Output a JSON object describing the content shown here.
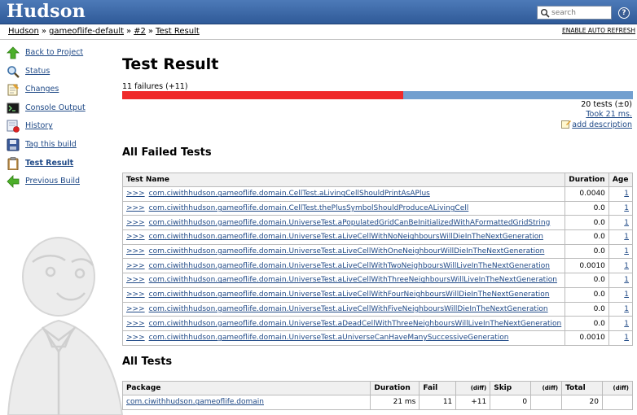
{
  "header": {
    "logo": "Hudson",
    "search_placeholder": "search",
    "help_glyph": "?"
  },
  "breadcrumb": {
    "items": [
      "Hudson",
      "gameoflife-default",
      "#2",
      "Test Result"
    ],
    "separator": "»",
    "auto_refresh": "ENABLE AUTO REFRESH"
  },
  "sidebar": {
    "items": [
      {
        "label": "Back to Project",
        "icon": "up-arrow-icon"
      },
      {
        "label": "Status",
        "icon": "magnifier-icon"
      },
      {
        "label": "Changes",
        "icon": "notepad-icon"
      },
      {
        "label": "Console Output",
        "icon": "terminal-icon"
      },
      {
        "label": "History",
        "icon": "history-icon"
      },
      {
        "label": "Tag this build",
        "icon": "floppy-disk-icon"
      },
      {
        "label": "Test Result",
        "icon": "clipboard-icon"
      },
      {
        "label": "Previous Build",
        "icon": "left-arrow-icon"
      }
    ]
  },
  "main": {
    "title": "Test Result",
    "failures": "11 failures (+11)",
    "fail_fraction": 0.55,
    "tests": "20 tests (±0)",
    "took": "Took 21 ms.",
    "add_description": "add description"
  },
  "failed": {
    "heading": "All Failed Tests",
    "columns": {
      "name": "Test Name",
      "duration": "Duration",
      "age": "Age"
    },
    "arrow": ">>>",
    "rows": [
      {
        "name": "com.ciwithhudson.gameoflife.domain.CellTest.aLivingCellShouldPrintAsAPlus",
        "duration": "0.0040",
        "age": "1"
      },
      {
        "name": "com.ciwithhudson.gameoflife.domain.CellTest.thePlusSymbolShouldProduceALivingCell",
        "duration": "0.0",
        "age": "1"
      },
      {
        "name": "com.ciwithhudson.gameoflife.domain.UniverseTest.aPopulatedGridCanBeInitializedWithAFormattedGridString",
        "duration": "0.0",
        "age": "1"
      },
      {
        "name": "com.ciwithhudson.gameoflife.domain.UniverseTest.aLiveCellWithNoNeighboursWillDieInTheNextGeneration",
        "duration": "0.0",
        "age": "1"
      },
      {
        "name": "com.ciwithhudson.gameoflife.domain.UniverseTest.aLiveCellWithOneNeighbourWillDieInTheNextGeneration",
        "duration": "0.0",
        "age": "1"
      },
      {
        "name": "com.ciwithhudson.gameoflife.domain.UniverseTest.aLiveCellWithTwoNeighboursWillLiveInTheNextGeneration",
        "duration": "0.0010",
        "age": "1"
      },
      {
        "name": "com.ciwithhudson.gameoflife.domain.UniverseTest.aLiveCellWithThreeNeighboursWillLiveInTheNextGeneration",
        "duration": "0.0",
        "age": "1"
      },
      {
        "name": "com.ciwithhudson.gameoflife.domain.UniverseTest.aLiveCellWithFourNeighboursWillDieInTheNextGeneration",
        "duration": "0.0",
        "age": "1"
      },
      {
        "name": "com.ciwithhudson.gameoflife.domain.UniverseTest.aLiveCellWithFiveNeighboursWillDieInTheNextGeneration",
        "duration": "0.0",
        "age": "1"
      },
      {
        "name": "com.ciwithhudson.gameoflife.domain.UniverseTest.aDeadCellWithThreeNeighboursWillLiveInTheNextGeneration",
        "duration": "0.0",
        "age": "1"
      },
      {
        "name": "com.ciwithhudson.gameoflife.domain.UniverseTest.aUniverseCanHaveManySuccessiveGeneration",
        "duration": "0.0010",
        "age": "1"
      }
    ]
  },
  "all": {
    "heading": "All Tests",
    "columns": {
      "package": "Package",
      "duration": "Duration",
      "fail": "Fail",
      "diff1": "(diff)",
      "skip": "Skip",
      "diff2": "(diff)",
      "total": "Total",
      "diff3": "(diff)"
    },
    "rows": [
      {
        "package": "com.ciwithhudson.gameoflife.domain",
        "duration": "21 ms",
        "fail": "11",
        "fail_diff": "+11",
        "skip": "0",
        "skip_diff": "",
        "total": "20",
        "total_diff": ""
      }
    ]
  },
  "colors": {
    "header": "#3b66a6",
    "fail_bar": "#ef2929",
    "pass_bar": "#729fcf",
    "link": "#204a87"
  }
}
